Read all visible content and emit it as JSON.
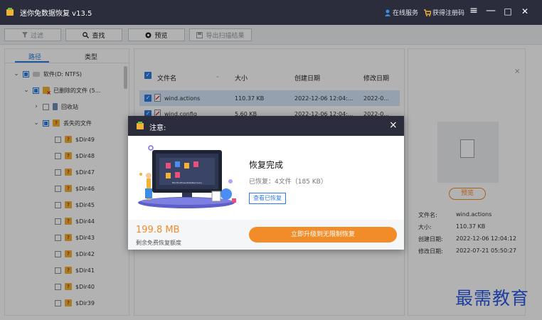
{
  "app": {
    "title": "迷你兔数据恢复 v13.5",
    "links": [
      "在线服务",
      "获得注册码"
    ],
    "window_controls": [
      "≡",
      "—",
      "□",
      "✕"
    ]
  },
  "toolbar": {
    "filter_label": "过滤",
    "search_label": "查找",
    "preview_label": "预览",
    "export_label": "导出扫描结果"
  },
  "left": {
    "tabs": [
      "路径",
      "类型"
    ],
    "tree": [
      {
        "label": "软件(D: NTFS)"
      },
      {
        "label": "已删除的文件 (5..."
      },
      {
        "label": "回收站"
      },
      {
        "label": "丢失的文件"
      },
      {
        "label": "$Dir49"
      },
      {
        "label": "$Dir48"
      },
      {
        "label": "$Dir47"
      },
      {
        "label": "$Dir46"
      },
      {
        "label": "$Dir45"
      },
      {
        "label": "$Dir44"
      },
      {
        "label": "$Dir43"
      },
      {
        "label": "$Dir42"
      },
      {
        "label": "$Dir41"
      },
      {
        "label": "$Dir40"
      },
      {
        "label": "$Dir39"
      }
    ]
  },
  "table": {
    "headers": [
      "文件名",
      "大小",
      "创建日期",
      "修改日期"
    ],
    "rows": [
      {
        "name": "wind.actions",
        "size": "110.37 KB",
        "created": "2022-12-06 12:04:...",
        "modified": "2022-0..."
      },
      {
        "name": "wind.config",
        "size": "5.60 KB",
        "created": "2022-12-06 12:04:...",
        "modified": "2022-0..."
      }
    ]
  },
  "right": {
    "preview_button": "预览",
    "info": [
      {
        "label": "文件名:",
        "value": "wind.actions"
      },
      {
        "label": "大小:",
        "value": "110.37 KB"
      },
      {
        "label": "创建日期:",
        "value": "2022-12-06 12:04:12"
      },
      {
        "label": "修改日期:",
        "value": "2022-07-21 05:50:27"
      }
    ]
  },
  "modal": {
    "title": "注意:",
    "heading": "恢复完成",
    "summary": "已恢复：4文件（185 KB）",
    "view_button": "查看已恢复",
    "remaining_size": "199.8 MB",
    "remaining_caption": "剩余免费恢复额度",
    "upgrade_button": "立即升级到无限制恢复",
    "illus_caption": "MiniToolPowerDataRecovery"
  },
  "watermark": "最需教育",
  "colors": {
    "titlebar": "#2b2d3c",
    "accent": "#2b7be4",
    "orange": "#f28c28"
  }
}
